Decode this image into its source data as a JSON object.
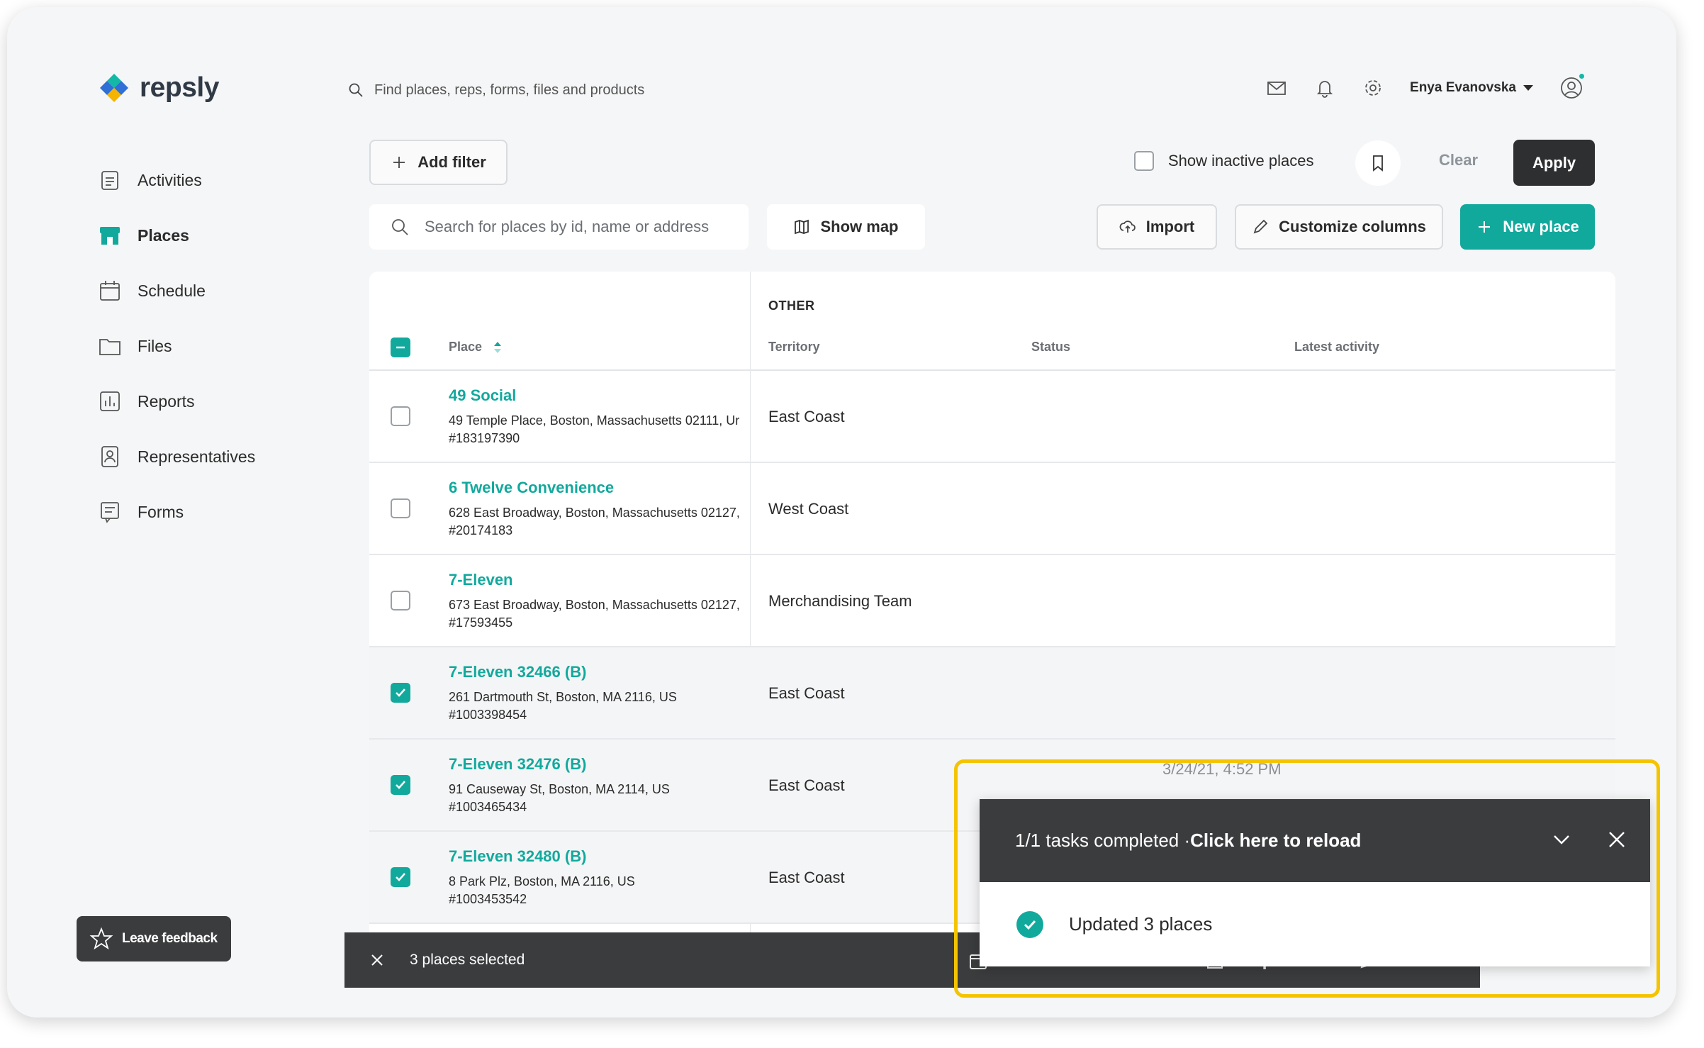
{
  "brand": {
    "name": "repsly",
    "accent": "#12a99d",
    "highlight": "#f5c400"
  },
  "header": {
    "search_placeholder": "Find places, reps, forms, files and products",
    "icons": [
      "mail-icon",
      "bell-icon",
      "gear-icon",
      "user-avatar-icon"
    ],
    "user_name": "Enya Evanovska"
  },
  "sidebar": {
    "items": [
      {
        "label": "Activities",
        "icon": "clipboard-icon"
      },
      {
        "label": "Places",
        "icon": "store-icon",
        "active": true
      },
      {
        "label": "Schedule",
        "icon": "calendar-icon"
      },
      {
        "label": "Files",
        "icon": "folder-icon"
      },
      {
        "label": "Reports",
        "icon": "chart-icon"
      },
      {
        "label": "Representatives",
        "icon": "person-badge-icon"
      },
      {
        "label": "Forms",
        "icon": "form-icon"
      }
    ],
    "feedback_label": "Leave feedback"
  },
  "filters": {
    "add_filter": "Add filter",
    "show_inactive": "Show inactive places",
    "clear": "Clear",
    "apply": "Apply"
  },
  "toolbar": {
    "search_placeholder": "Search for places by id, name or address",
    "show_map": "Show map",
    "import": "Import",
    "customize_columns": "Customize columns",
    "new_place": "New place"
  },
  "table": {
    "group_header": "OTHER",
    "columns": [
      "Place",
      "Territory",
      "Status",
      "Latest activity"
    ],
    "rows": [
      {
        "name": "49 Social",
        "address": "49 Temple Place, Boston, Massachusetts 02111, Ur",
        "id": "#183197390",
        "territory": "East Coast",
        "selected": false
      },
      {
        "name": "6 Twelve Convenience",
        "address": "628 East Broadway, Boston, Massachusetts 02127,",
        "id": "#20174183",
        "territory": "West Coast",
        "selected": false
      },
      {
        "name": "7-Eleven",
        "address": "673 East Broadway, Boston, Massachusetts 02127,",
        "id": "#17593455",
        "territory": "Merchandising Team",
        "selected": false
      },
      {
        "name": "7-Eleven 32466 (B)",
        "address": "261 Dartmouth St, Boston, MA 2116, US",
        "id": "#1003398454",
        "territory": "East Coast",
        "selected": true
      },
      {
        "name": "7-Eleven 32476 (B)",
        "address": "91 Causeway St, Boston, MA 2114, US",
        "id": "#1003465434",
        "territory": "East Coast",
        "selected": true
      },
      {
        "name": "7-Eleven 32480 (B)",
        "address": "8 Park Plz, Boston, MA 2116, US",
        "id": "#1003453542",
        "territory": "East Coast",
        "selected": true
      }
    ],
    "partial_latest_activity": "3/24/21, 4:52 PM"
  },
  "selection_bar": {
    "count_label": "3 places selected",
    "schedule": "Schedule a visit",
    "export": "Export",
    "edit": "Edit"
  },
  "toast": {
    "status": "1/1 tasks completed · ",
    "link": "Click here to reload",
    "message": "Updated 3 places"
  }
}
